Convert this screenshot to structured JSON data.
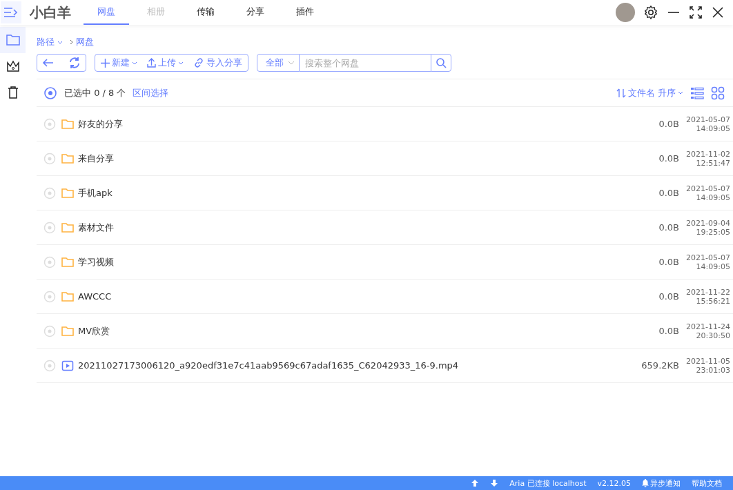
{
  "app": {
    "title": "小白羊"
  },
  "tabs": [
    {
      "label": "网盘",
      "selected": true,
      "disabled": false
    },
    {
      "label": "相册",
      "selected": false,
      "disabled": true
    },
    {
      "label": "传输",
      "selected": false,
      "disabled": false
    },
    {
      "label": "分享",
      "selected": false,
      "disabled": false
    },
    {
      "label": "插件",
      "selected": false,
      "disabled": false
    }
  ],
  "sidebar": {
    "items": [
      {
        "kind": "folder",
        "selected": true
      },
      {
        "kind": "crown",
        "selected": false
      },
      {
        "kind": "trash",
        "selected": false
      }
    ]
  },
  "breadcrumb": {
    "root": "路径",
    "path": [
      "网盘"
    ]
  },
  "toolbar": {
    "new": "新建",
    "upload": "上传",
    "import": "导入分享",
    "filter": "全部",
    "search_placeholder": "搜索整个网盘"
  },
  "selection": {
    "all_selected": false,
    "count": "已选中 0 / 8 个",
    "range": "区间选择",
    "sort": "文件名 升序"
  },
  "rows": [
    {
      "kind": "folder",
      "name": "好友的分享",
      "size": "0.0B",
      "date": "2021-05-07",
      "time": "14:09:05",
      "selected": false
    },
    {
      "kind": "folder",
      "name": "来自分享",
      "size": "0.0B",
      "date": "2021-11-02",
      "time": "12:51:47",
      "selected": false
    },
    {
      "kind": "folder",
      "name": "手机apk",
      "size": "0.0B",
      "date": "2021-05-07",
      "time": "14:09:05",
      "selected": false
    },
    {
      "kind": "folder",
      "name": "素材文件",
      "size": "0.0B",
      "date": "2021-09-04",
      "time": "19:25:05",
      "selected": false
    },
    {
      "kind": "folder",
      "name": "学习视频",
      "size": "0.0B",
      "date": "2021-05-07",
      "time": "14:09:05",
      "selected": false
    },
    {
      "kind": "folder",
      "name": "AWCCC",
      "size": "0.0B",
      "date": "2021-11-22",
      "time": "15:56:21",
      "selected": false
    },
    {
      "kind": "folder",
      "name": "MV欣赏",
      "size": "0.0B",
      "date": "2021-11-24",
      "time": "20:30:50",
      "selected": false
    },
    {
      "kind": "video",
      "name": "20211027173006120_a920edf31e7c41aab9569c67adaf1635_C62042933_16-9.mp4",
      "size": "659.2KB",
      "date": "2021-11-05",
      "time": "23:01:03",
      "selected": false
    }
  ],
  "status_bar": {
    "aria": "Aria 已连接 localhost",
    "version": "v2.12.05",
    "notify": "异步通知",
    "help": "帮助文档"
  }
}
